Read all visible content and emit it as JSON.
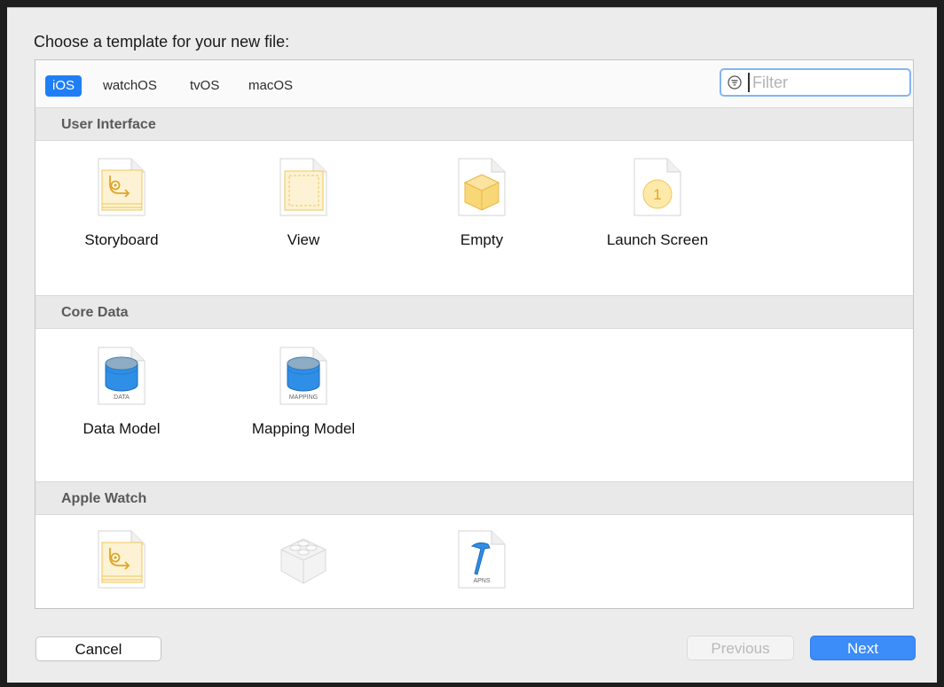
{
  "dialog": {
    "title": "Choose a template for your new file:"
  },
  "tabs": [
    {
      "label": "iOS",
      "selected": true
    },
    {
      "label": "watchOS",
      "selected": false
    },
    {
      "label": "tvOS",
      "selected": false
    },
    {
      "label": "macOS",
      "selected": false
    }
  ],
  "filter": {
    "placeholder": "Filter",
    "value": ""
  },
  "sections": [
    {
      "title": "User Interface",
      "items": [
        {
          "label": "Storyboard",
          "icon": "storyboard-file-icon"
        },
        {
          "label": "View",
          "icon": "view-file-icon"
        },
        {
          "label": "Empty",
          "icon": "empty-file-icon"
        },
        {
          "label": "Launch Screen",
          "icon": "launch-screen-file-icon"
        }
      ]
    },
    {
      "title": "Core Data",
      "items": [
        {
          "label": "Data Model",
          "icon": "data-model-file-icon",
          "badge": "DATA"
        },
        {
          "label": "Mapping Model",
          "icon": "mapping-model-file-icon",
          "badge": "MAPPING"
        }
      ]
    },
    {
      "title": "Apple Watch",
      "items": [
        {
          "label": "",
          "icon": "watch-storyboard-file-icon"
        },
        {
          "label": "",
          "icon": "lego-brick-icon"
        },
        {
          "label": "",
          "icon": "apns-file-icon",
          "badge": "APNS"
        }
      ]
    }
  ],
  "launch_screen_badge": "1",
  "buttons": {
    "cancel": "Cancel",
    "previous": "Previous",
    "next": "Next"
  },
  "colors": {
    "accent": "#1f7ef5",
    "next_button": "#3c8cf9",
    "file_icon_yellow": "#f2c94c",
    "cylinder_blue": "#2f8ee6"
  }
}
